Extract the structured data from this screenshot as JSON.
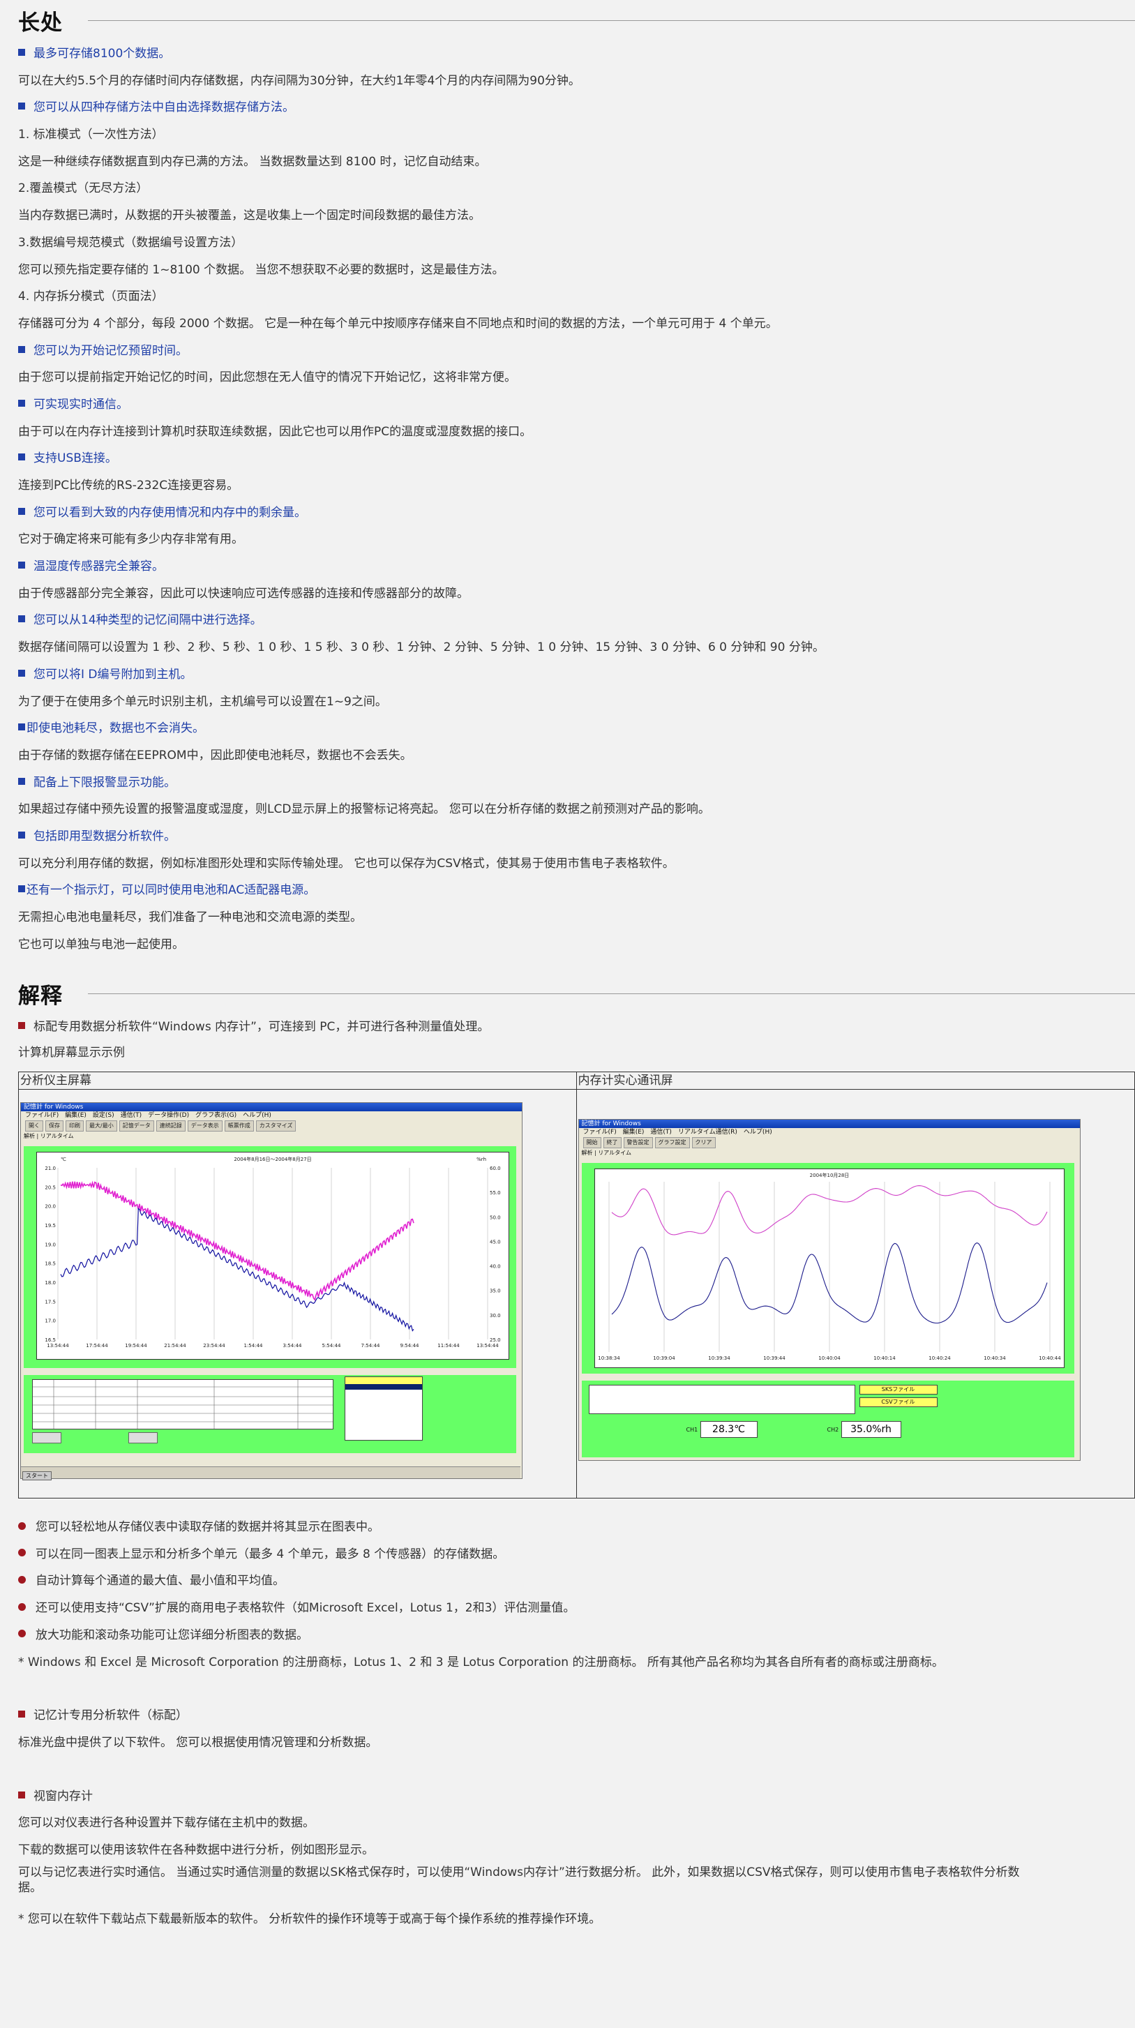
{
  "sections": {
    "features_title": "长处",
    "explain_title": "解释"
  },
  "features": [
    {
      "kind": "feat",
      "text": "最多可存储8100个数据。"
    },
    {
      "kind": "text",
      "text": "可以在大约5.5个月的存储时间内存储数据，内存间隔为30分钟，在大约1年零4个月的内存间隔为90分钟。"
    },
    {
      "kind": "feat",
      "text": "您可以从四种存储方法中自由选择数据存储方法。"
    },
    {
      "kind": "text",
      "text": "1. 标准模式（一次性方法）"
    },
    {
      "kind": "text",
      "text": "这是一种继续存储数据直到内存已满的方法。 当数据数量达到 8100 时，记忆自动结束。"
    },
    {
      "kind": "text",
      "text": "2.覆盖模式（无尽方法）"
    },
    {
      "kind": "text",
      "text": "当内存数据已满时，从数据的开头被覆盖，这是收集上一个固定时间段数据的最佳方法。"
    },
    {
      "kind": "text",
      "text": "3.数据编号规范模式（数据编号设置方法）"
    },
    {
      "kind": "text",
      "text": "您可以预先指定要存储的 1~8100 个数据。 当您不想获取不必要的数据时，这是最佳方法。"
    },
    {
      "kind": "text",
      "text": "4. 内存拆分模式（页面法）"
    },
    {
      "kind": "text",
      "text": "存储器可分为 4 个部分，每段 2000 个数据。 它是一种在每个单元中按顺序存储来自不同地点和时间的数据的方法，一个单元可用于 4 个单元。"
    },
    {
      "kind": "feat",
      "text": "您可以为开始记忆预留时间。"
    },
    {
      "kind": "text",
      "text": "由于您可以提前指定开始记忆的时间，因此您想在无人值守的情况下开始记忆，这将非常方便。"
    },
    {
      "kind": "feat",
      "text": "可实现实时通信。"
    },
    {
      "kind": "text",
      "text": "由于可以在内存计连接到计算机时获取连续数据，因此它也可以用作PC的温度或湿度数据的接口。"
    },
    {
      "kind": "feat",
      "text": "支持USB连接。"
    },
    {
      "kind": "text",
      "text": "连接到PC比传统的RS-232C连接更容易。"
    },
    {
      "kind": "feat",
      "text": "您可以看到大致的内存使用情况和内存中的剩余量。"
    },
    {
      "kind": "text",
      "text": "它对于确定将来可能有多少内存非常有用。"
    },
    {
      "kind": "feat",
      "text": "温湿度传感器完全兼容。"
    },
    {
      "kind": "text",
      "text": "由于传感器部分完全兼容，因此可以快速响应可选传感器的连接和传感器部分的故障。"
    },
    {
      "kind": "feat",
      "text": "您可以从14种类型的记忆间隔中进行选择。"
    },
    {
      "kind": "text",
      "text": "数据存储间隔可以设置为 1 秒、2 秒、5 秒、1 0 秒、1 5 秒、3 0 秒、1 分钟、2 分钟、5 分钟、1 0 分钟、15 分钟、3 0 分钟、6 0 分钟和 90 分钟。"
    },
    {
      "kind": "feat",
      "text": "您可以将I D编号附加到主机。"
    },
    {
      "kind": "text",
      "text": "为了便于在使用多个单元时识别主机，主机编号可以设置在1~9之间。"
    },
    {
      "kind": "feat2",
      "text": "即使电池耗尽，数据也不会消失。"
    },
    {
      "kind": "text",
      "text": "由于存储的数据存储在EEPROM中，因此即使电池耗尽，数据也不会丢失。"
    },
    {
      "kind": "feat",
      "text": "配备上下限报警显示功能。"
    },
    {
      "kind": "text",
      "text": "如果超过存储中预先设置的报警温度或湿度，则LCD显示屏上的报警标记将亮起。 您可以在分析存储的数据之前预测对产品的影响。"
    },
    {
      "kind": "feat",
      "text": "包括即用型数据分析软件。"
    },
    {
      "kind": "text",
      "text": "可以充分利用存储的数据，例如标准图形处理和实际传输处理。 它也可以保存为CSV格式，使其易于使用市售电子表格软件。"
    },
    {
      "kind": "feat2",
      "text": "还有一个指示灯，可以同时使用电池和AC适配器电源。"
    },
    {
      "kind": "text",
      "text": "无需担心电池电量耗尽，我们准备了一种电池和交流电源的类型。"
    },
    {
      "kind": "text",
      "text": "它也可以单独与电池一起使用。"
    }
  ],
  "explain": {
    "intro": "标配专用数据分析软件“Windows 内存计”，可连接到 PC，并可进行各种测量值处理。",
    "caption": "计算机屏幕显示示例",
    "col1": "分析仪主屏幕",
    "col2": "内存计实心通讯屏",
    "shot1": {
      "title": "記憶計 for Windows",
      "menu": "ファイル(F)　編集(E)　設定(S)　通信(T)　データ操作(D)　グラフ表示(G)　ヘルプ(H)",
      "tabs": [
        "解析",
        "リアルタイム"
      ],
      "toolbar": [
        "開く",
        "保存",
        "印刷",
        "最大/最小",
        "記憶データ",
        "連続記録",
        "データ表示",
        "帳票作成",
        "カスタマイズ"
      ],
      "chart_title": "2004年8月16日～2004年8月27日",
      "xticks": [
        "13:54:44",
        "17:54:44",
        "19:54:44",
        "21:54:44",
        "23:54:44",
        "1:54:44",
        "3:54:44",
        "5:54:44",
        "7:54:44",
        "9:54:44",
        "11:54:44",
        "13:54:44"
      ],
      "y_left": [
        "21.0",
        "20.5",
        "20.0",
        "19.5",
        "19.0",
        "18.5",
        "18.0",
        "17.5",
        "17.0",
        "16.5"
      ],
      "y_right": [
        "60.0",
        "55.0",
        "50.0",
        "45.0",
        "40.0",
        "35.0",
        "30.0",
        "25.0"
      ],
      "unit_left": "℃",
      "unit_right": "%rh",
      "taskbar_start": "スタート"
    },
    "shot2": {
      "title": "記憶計 for Windows",
      "menu": "ファイル(F)　編集(E)　通信(T)　リアルタイム通信(R)　ヘルプ(H)",
      "tabs": [
        "解析",
        "リアルタイム"
      ],
      "toolbar": [
        "開始",
        "終了",
        "警告設定",
        "グラフ設定",
        "クリア"
      ],
      "chart_title": "2004年10月28日",
      "xticks": [
        "10:38:34",
        "10:39:04",
        "10:39:34",
        "10:39:44",
        "10:40:04",
        "10:40:14",
        "10:40:24",
        "10:40:34",
        "10:40:44"
      ],
      "ch1_label": "CH1",
      "ch1_value": "28.3℃",
      "ch2_label": "CH2",
      "ch2_value": "35.0%rh",
      "btn1": "SKSファイル",
      "btn2": "CSVファイル"
    },
    "bullets": [
      "您可以轻松地从存储仪表中读取存储的数据并将其显示在图表中。",
      "可以在同一图表上显示和分析多个单元（最多 4 个单元，最多 8 个传感器）的存储数据。",
      "自动计算每个通道的最大值、最小值和平均值。",
      "还可以使用支持“CSV”扩展的商用电子表格软件（如Microsoft Excel，Lotus 1，2和3）评估测量值。",
      "放大功能和滚动条功能可让您详细分析图表的数据。"
    ],
    "trademark": "* Windows 和 Excel 是 Microsoft Corporation 的注册商标，Lotus 1、2 和 3 是 Lotus Corporation 的注册商标。 所有其他产品名称均为其各自所有者的商标或注册商标。",
    "software_head": "记忆计专用分析软件（标配）",
    "software_text": "标准光盘中提供了以下软件。 您可以根据使用情况管理和分析数据。",
    "window_head": "视窗内存计",
    "window_lines": [
      "您可以对仪表进行各种设置并下载存储在主机中的数据。",
      "下载的数据可以使用该软件在各种数据中进行分析，例如图形显示。",
      "可以与记忆表进行实时通信。 当通过实时通信测量的数据以SK格式保存时，可以使用“Windows内存计”进行数据分析。 此外，如果数据以CSV格式保存，则可以使用市售电子表格软件分析数",
      "据。"
    ],
    "final_note": "* 您可以在软件下载站点下载最新版本的软件。 分析软件的操作环境等于或高于每个操作系统的推荐操作环境。"
  }
}
